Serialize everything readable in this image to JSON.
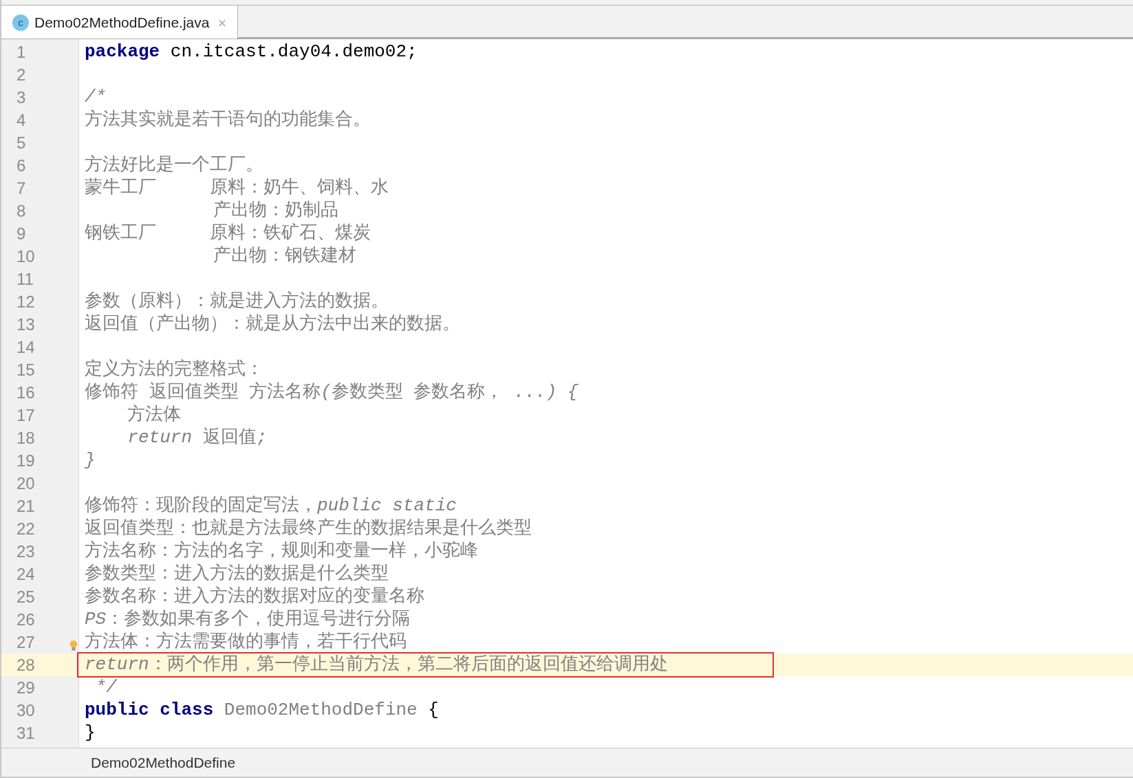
{
  "tabs": [
    {
      "label": "Demo02MethodDefine.java",
      "icon": "c",
      "close": "×",
      "selected": true
    }
  ],
  "lines": [
    {
      "number": "1",
      "current": false,
      "segments": [
        {
          "kind": "keyword",
          "text": "package"
        },
        {
          "kind": "plain",
          "text": " cn.itcast.day04.demo02;"
        }
      ]
    },
    {
      "number": "2",
      "current": false
    },
    {
      "number": "3",
      "current": false,
      "segments": [
        {
          "kind": "comment_italic",
          "text": "/*"
        }
      ]
    },
    {
      "number": "4",
      "current": false,
      "segments": [
        {
          "kind": "comment",
          "text": "方法其实就是若干语句的功能集合。"
        }
      ]
    },
    {
      "number": "5",
      "current": false
    },
    {
      "number": "6",
      "current": false,
      "segments": [
        {
          "kind": "comment",
          "text": "方法好比是一个工厂。"
        }
      ]
    },
    {
      "number": "7",
      "current": false,
      "segments": [
        {
          "kind": "comment",
          "text": "蒙牛工厂     原料：奶牛、饲料、水"
        }
      ]
    },
    {
      "number": "8",
      "current": false,
      "segments": [
        {
          "kind": "comment",
          "text": "            产出物：奶制品"
        }
      ]
    },
    {
      "number": "9",
      "current": false,
      "segments": [
        {
          "kind": "comment",
          "text": "钢铁工厂     原料：铁矿石、煤炭"
        }
      ]
    },
    {
      "number": "10",
      "current": false,
      "segments": [
        {
          "kind": "comment",
          "text": "            产出物：钢铁建材"
        }
      ]
    },
    {
      "number": "11",
      "current": false
    },
    {
      "number": "12",
      "current": false,
      "segments": [
        {
          "kind": "comment",
          "text": "参数（原料）：就是进入方法的数据。"
        }
      ]
    },
    {
      "number": "13",
      "current": false,
      "segments": [
        {
          "kind": "comment",
          "text": "返回值（产出物）：就是从方法中出来的数据。"
        }
      ]
    },
    {
      "number": "14",
      "current": false
    },
    {
      "number": "15",
      "current": false,
      "segments": [
        {
          "kind": "comment",
          "text": "定义方法的完整格式："
        }
      ]
    },
    {
      "number": "16",
      "current": false,
      "segments": [
        {
          "kind": "comment",
          "text": "修饰符 返回值类型 方法名称"
        },
        {
          "kind": "comment_italic",
          "text": "("
        },
        {
          "kind": "comment",
          "text": "参数类型 参数名称，"
        },
        {
          "kind": "comment_italic",
          "text": " ...) {"
        }
      ]
    },
    {
      "number": "17",
      "current": false,
      "segments": [
        {
          "kind": "comment",
          "text": "    方法体"
        }
      ]
    },
    {
      "number": "18",
      "current": false,
      "segments": [
        {
          "kind": "comment_italic",
          "text": "    return "
        },
        {
          "kind": "comment",
          "text": "返回值"
        },
        {
          "kind": "comment_italic",
          "text": ";"
        }
      ]
    },
    {
      "number": "19",
      "current": false,
      "segments": [
        {
          "kind": "comment_italic",
          "text": "}"
        }
      ]
    },
    {
      "number": "20",
      "current": false
    },
    {
      "number": "21",
      "current": false,
      "segments": [
        {
          "kind": "comment",
          "text": "修饰符：现阶段的固定写法，"
        },
        {
          "kind": "comment_italic",
          "text": "public static"
        }
      ]
    },
    {
      "number": "22",
      "current": false,
      "segments": [
        {
          "kind": "comment",
          "text": "返回值类型：也就是方法最终产生的数据结果是什么类型"
        }
      ]
    },
    {
      "number": "23",
      "current": false,
      "segments": [
        {
          "kind": "comment",
          "text": "方法名称：方法的名字，规则和变量一样，小驼峰"
        }
      ]
    },
    {
      "number": "24",
      "current": false,
      "segments": [
        {
          "kind": "comment",
          "text": "参数类型：进入方法的数据是什么类型"
        }
      ]
    },
    {
      "number": "25",
      "current": false,
      "segments": [
        {
          "kind": "comment",
          "text": "参数名称：进入方法的数据对应的变量名称"
        }
      ]
    },
    {
      "number": "26",
      "current": false,
      "segments": [
        {
          "kind": "comment_italic",
          "text": "PS"
        },
        {
          "kind": "comment",
          "text": "：参数如果有多个，使用逗号进行分隔"
        }
      ]
    },
    {
      "number": "27",
      "current": false,
      "bulb": true,
      "segments": [
        {
          "kind": "comment",
          "text": "方法体：方法需要做的事情，若干行代码"
        }
      ]
    },
    {
      "number": "28",
      "current": true,
      "outlined": true,
      "segments": [
        {
          "kind": "comment_italic",
          "text": "return"
        },
        {
          "kind": "comment",
          "text": "：两个作用，第一停止当前方法，第二将后面的返回值还给调用处"
        }
      ]
    },
    {
      "number": "29",
      "current": false,
      "segments": [
        {
          "kind": "comment_italic",
          "text": " */"
        }
      ]
    },
    {
      "number": "30",
      "current": false,
      "segments": [
        {
          "kind": "keyword",
          "text": "public class "
        },
        {
          "kind": "unused",
          "text": "Demo02MethodDefine"
        },
        {
          "kind": "plain",
          "text": " {"
        }
      ]
    },
    {
      "number": "31",
      "current": false,
      "segments": [
        {
          "kind": "plain",
          "text": "}"
        }
      ]
    }
  ],
  "breadcrumb": "Demo02MethodDefine"
}
